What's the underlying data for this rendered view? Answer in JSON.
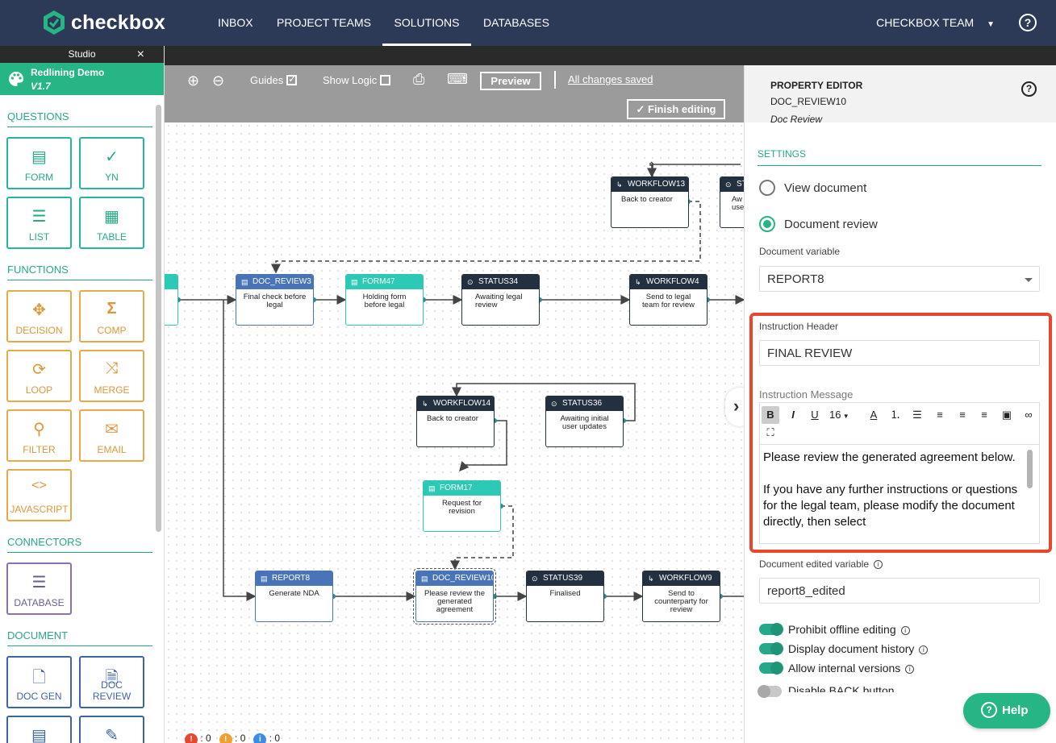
{
  "nav": {
    "logo": "checkbox",
    "items": [
      "INBOX",
      "PROJECT TEAMS",
      "SOLUTIONS",
      "DATABASES"
    ],
    "active": "SOLUTIONS",
    "team": "CHECKBOX TEAM",
    "help": "?"
  },
  "sidebar": {
    "studio_label": "Studio",
    "close": "×",
    "app_title": "Redlining Demo",
    "app_version": "V1.7",
    "sections": {
      "questions": "QUESTIONS",
      "functions": "FUNCTIONS",
      "connectors": "CONNECTORS",
      "document": "DOCUMENT"
    },
    "tools": {
      "form": "FORM",
      "yn": "YN",
      "list": "LIST",
      "table": "TABLE",
      "decision": "DECISION",
      "comp": "COMP",
      "loop": "LOOP",
      "merge": "MERGE",
      "filter": "FILTER",
      "email": "EMAIL",
      "javascript": "JAVASCRIPT",
      "database": "DATABASE",
      "doc_gen": "DOC GEN",
      "doc_review": "DOC REVIEW"
    }
  },
  "toolbar": {
    "guides": "Guides",
    "guides_checked": true,
    "show_logic": "Show Logic",
    "show_logic_checked": false,
    "preview": "Preview",
    "saved": "All changes saved",
    "finish": "Finish editing"
  },
  "nodes": {
    "workflow13": {
      "header": "WORKFLOW13",
      "body": "Back to creator"
    },
    "st_partial": {
      "header": "ST",
      "body": "Aw use"
    },
    "doc_review3": {
      "header": "DOC_REVIEW3",
      "body": "Final check before legal"
    },
    "form47": {
      "header": "FORM47",
      "body": "Holding form before legal"
    },
    "status34": {
      "header": "STATUS34",
      "body": "Awaiting legal review"
    },
    "workflow4": {
      "header": "WORKFLOW4",
      "body": "Send to legal team for review"
    },
    "workflow14": {
      "header": "WORKFLOW14",
      "body": "Back to creator"
    },
    "status36": {
      "header": "STATUS36",
      "body": "Awaiting initial user updates"
    },
    "form17": {
      "header": "FORM17",
      "body": "Request for revision"
    },
    "report8": {
      "header": "REPORT8",
      "body": "Generate NDA"
    },
    "doc_review10": {
      "header": "DOC_REVIEW10",
      "body": "Please review the generated agreement"
    },
    "status39": {
      "header": "STATUS39",
      "body": "Finalised"
    },
    "workflow9": {
      "header": "WORKFLOW9",
      "body": "Send to counterparty for review"
    }
  },
  "status_counts": {
    "errors": "0",
    "warnings": "0",
    "info": "0"
  },
  "property_editor": {
    "title": "PROPERTY EDITOR",
    "name": "DOC_REVIEW10",
    "type": "Doc Review",
    "settings": "SETTINGS",
    "radio_view": "View document",
    "radio_review": "Document review",
    "doc_var_label": "Document variable",
    "doc_var_value": "REPORT8",
    "instr_header_label": "Instruction Header",
    "instr_header_value": "FINAL REVIEW",
    "instr_msg_label": "Instruction Message",
    "font_size": "16",
    "msg_p1": "Please review the generated agreement below.",
    "msg_p2": "If you have any further instructions or questions for the legal team, please modify the document directly, then select",
    "edited_var_label": "Document edited variable",
    "edited_var_value": "report8_edited",
    "toggles": {
      "offline": "Prohibit offline editing",
      "history": "Display document history",
      "internal": "Allow internal versions",
      "back": "Disable BACK button"
    },
    "help_button": "Help"
  },
  "colors": {
    "nav_bg": "#2d3a57",
    "accent_green": "#26b584",
    "highlight_red": "#e8472e"
  }
}
